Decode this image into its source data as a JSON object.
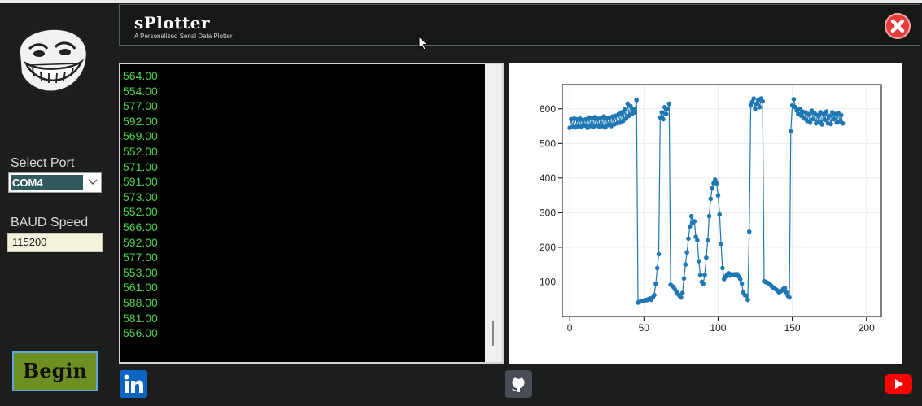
{
  "app": {
    "title": "sPlotter",
    "subtitle": "A Personalized Serial Data Plotter",
    "close_icon": "close-icon"
  },
  "sidebar": {
    "logo_icon": "trollface-logo",
    "port_label": "Select Port",
    "port_value": "COM4",
    "baud_label": "BAUD Speed",
    "baud_value": "115200",
    "begin_label": "Begin"
  },
  "serial_monitor": {
    "lines": [
      "564.00",
      "554.00",
      "577.00",
      "592.00",
      "569.00",
      "552.00",
      "571.00",
      "591.00",
      "573.00",
      "552.00",
      "566.00",
      "592.00",
      "577.00",
      "553.00",
      "561.00",
      "588.00",
      "581.00",
      "556.00"
    ],
    "text_color": "#4bd34b"
  },
  "footer": {
    "icons": [
      "linkedin-icon",
      "github-icon",
      "youtube-icon"
    ]
  },
  "colors": {
    "accent": "#1f77b4",
    "begin_button": "#6e8f22",
    "close": "#e63c3c"
  },
  "chart_data": {
    "type": "line",
    "title": "",
    "xlabel": "",
    "ylabel": "",
    "xlim": [
      -5,
      210
    ],
    "ylim": [
      0,
      670
    ],
    "xticks": [
      0,
      50,
      100,
      150,
      200
    ],
    "yticks": [
      100,
      200,
      300,
      400,
      500,
      600
    ],
    "grid": true,
    "series": [
      {
        "marker": "circle",
        "values": [
          545,
          570,
          548,
          572,
          546,
          570,
          550,
          572,
          548,
          568,
          552,
          570,
          545,
          575,
          550,
          573,
          547,
          576,
          552,
          571,
          548,
          574,
          550,
          578,
          546,
          572,
          553,
          575,
          550,
          578,
          555,
          580,
          558,
          585,
          560,
          590,
          565,
          598,
          572,
          615,
          580,
          608,
          585,
          600,
          590,
          625,
          40,
          42,
          44,
          45,
          46,
          48,
          47,
          50,
          52,
          48,
          55,
          62,
          95,
          140,
          180,
          575,
          590,
          570,
          605,
          585,
          600,
          615,
          92,
          88,
          85,
          78,
          70,
          65,
          60,
          55,
          68,
          110,
          150,
          185,
          225,
          260,
          290,
          270,
          275,
          230,
          220,
          160,
          120,
          100,
          95,
          120,
          170,
          220,
          290,
          340,
          370,
          385,
          395,
          385,
          350,
          295,
          210,
          140,
          108,
          115,
          120,
          125,
          118,
          122,
          120,
          122,
          120,
          122,
          115,
          108,
          95,
          70,
          62,
          60,
          48,
          245,
          610,
          620,
          630,
          600,
          615,
          625,
          605,
          630,
          622,
          102,
          100,
          98,
          96,
          92,
          88,
          84,
          82,
          78,
          75,
          70,
          72,
          75,
          80,
          82,
          70,
          60,
          55,
          535,
          610,
          628,
          605,
          595,
          585,
          600,
          580,
          592,
          572,
          590,
          565,
          585,
          560,
          595,
          570,
          588,
          558,
          582,
          562,
          590,
          555,
          585,
          568,
          592,
          558,
          580,
          556,
          590,
          570,
          585,
          560,
          588,
          564,
          582,
          558
        ]
      }
    ]
  }
}
